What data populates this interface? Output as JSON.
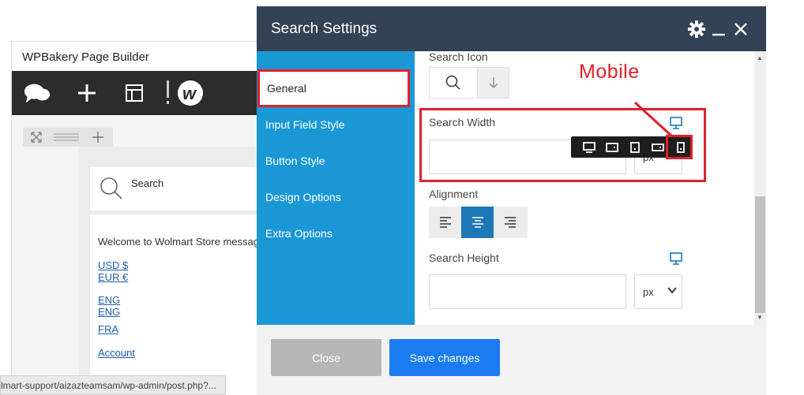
{
  "background": {
    "builder_title": "WPBakery Page Builder",
    "search_label": "Search",
    "welcome_text": "Welcome to Wolmart Store messag",
    "links": [
      "USD $",
      "EUR €",
      "ENG",
      "ENG",
      "FRA",
      "Account"
    ],
    "status_url": "lmart-support/aizazteamsam/wp-admin/post.php?..."
  },
  "modal": {
    "title": "Search Settings",
    "tabs": [
      "General",
      "Input Field Style",
      "Button Style",
      "Design Options",
      "Extra Options"
    ],
    "active_tab": "General",
    "fields": {
      "search_icon_label": "Search Icon",
      "search_width_label": "Search Width",
      "search_width_value": "",
      "search_width_unit": "px",
      "alignment_label": "Alignment",
      "alignment_selected": "center",
      "search_height_label": "Search Height",
      "search_height_value": "",
      "search_height_unit": "px"
    },
    "device_options": [
      "desktop",
      "tablet-landscape",
      "tablet-portrait",
      "mobile-landscape",
      "mobile"
    ],
    "selected_device": "mobile",
    "footer": {
      "close_label": "Close",
      "save_label": "Save changes"
    }
  },
  "annotation": {
    "label": "Mobile",
    "color": "#e0202a"
  },
  "colors": {
    "header": "#344256",
    "sidebar": "#1a98d5",
    "primary": "#1a7cf0",
    "accent": "#1e78b8"
  }
}
